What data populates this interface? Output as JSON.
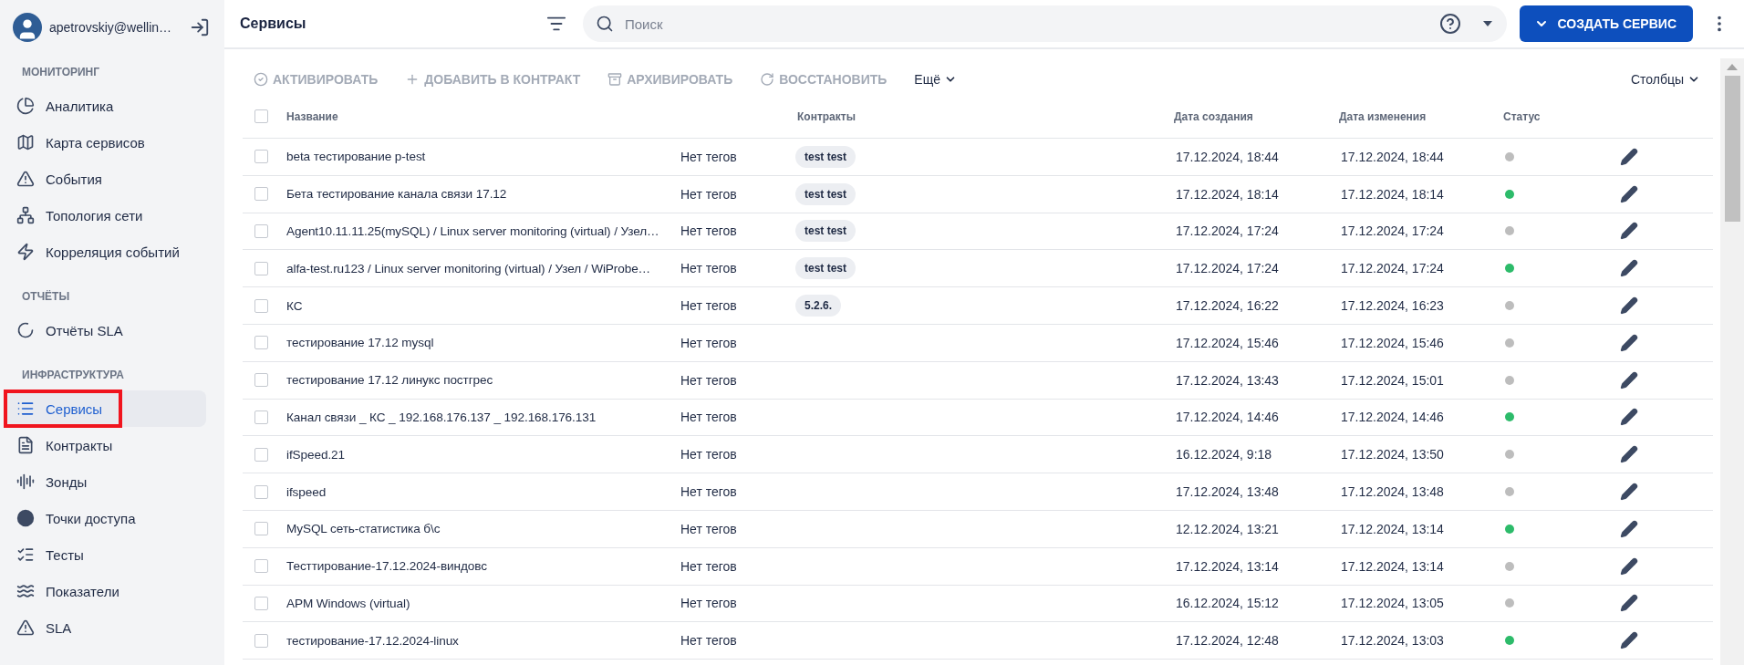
{
  "user": {
    "name": "apetrovskiy@wellin…"
  },
  "nav": [
    {
      "title": "МОНИТОРИНГ",
      "items": [
        {
          "label": "Аналитика",
          "selected": false,
          "highlighted": false
        },
        {
          "label": "Карта сервисов",
          "selected": false,
          "highlighted": false
        },
        {
          "label": "События",
          "selected": false,
          "highlighted": false
        },
        {
          "label": "Топология сети",
          "selected": false,
          "highlighted": false
        },
        {
          "label": "Корреляция событий",
          "selected": false,
          "highlighted": false
        }
      ]
    },
    {
      "title": "ОТЧЁТЫ",
      "items": [
        {
          "label": "Отчёты SLA",
          "selected": false,
          "highlighted": false
        }
      ]
    },
    {
      "title": "ИНФРАСТРУКТУРА",
      "items": [
        {
          "label": "Сервисы",
          "selected": true,
          "highlighted": true
        },
        {
          "label": "Контракты",
          "selected": false,
          "highlighted": false
        },
        {
          "label": "Зонды",
          "selected": false,
          "highlighted": false
        },
        {
          "label": "Точки доступа",
          "selected": false,
          "highlighted": false
        },
        {
          "label": "Тесты",
          "selected": false,
          "highlighted": false
        },
        {
          "label": "Показатели",
          "selected": false,
          "highlighted": false
        },
        {
          "label": "SLA",
          "selected": false,
          "highlighted": false
        }
      ]
    }
  ],
  "topbar": {
    "title": "Сервисы",
    "search": {
      "placeholder": "Поиск"
    },
    "create_button": "СОЗДАТЬ СЕРВИС"
  },
  "toolbar": {
    "actions": [
      {
        "label": "АКТИВИРОВАТЬ",
        "disabled": true
      },
      {
        "label": "ДОБАВИТЬ В КОНТРАКТ",
        "disabled": true
      },
      {
        "label": "АРХИВИРОВАТЬ",
        "disabled": true
      },
      {
        "label": "ВОССТАНОВИТЬ",
        "disabled": true
      }
    ],
    "more": "Ещё",
    "columns": "Столбцы"
  },
  "table": {
    "all_checked": false,
    "columns": [
      "Название",
      "Контракты",
      "Дата создания",
      "Дата изменения",
      "Статус"
    ],
    "rows": [
      {
        "name": "beta тестирование p-test",
        "tags": "Нет тегов",
        "contracts": [
          "test test"
        ],
        "created": "17.12.2024, 18:44",
        "modified": "17.12.2024, 18:44",
        "color": "#bdbdbd",
        "checked": false
      },
      {
        "name": "Бета тестирование канала связи 17.12",
        "tags": "Нет тегов",
        "contracts": [
          "test test"
        ],
        "created": "17.12.2024, 18:14",
        "modified": "17.12.2024, 18:14",
        "color": "#2dbb6a",
        "checked": false
      },
      {
        "name": "Agent10.11.11.25(mySQL) / Linux server monitoring (virtual) / Узел…",
        "tags": "Нет тегов",
        "contracts": [
          "test test"
        ],
        "created": "17.12.2024, 17:24",
        "modified": "17.12.2024, 17:24",
        "color": "#bdbdbd",
        "checked": false
      },
      {
        "name": "alfa-test.ru123 / Linux server monitoring (virtual) / Узел / WiProbe…",
        "tags": "Нет тегов",
        "contracts": [
          "test test"
        ],
        "created": "17.12.2024, 17:24",
        "modified": "17.12.2024, 17:24",
        "color": "#2dbb6a",
        "checked": false
      },
      {
        "name": "КС",
        "tags": "Нет тегов",
        "contracts": [
          "5.2.6."
        ],
        "created": "17.12.2024, 16:22",
        "modified": "17.12.2024, 16:23",
        "color": "#bdbdbd",
        "checked": false
      },
      {
        "name": "тестирование 17.12 mysql",
        "tags": "Нет тегов",
        "contracts": [],
        "created": "17.12.2024, 15:46",
        "modified": "17.12.2024, 15:46",
        "color": "#bdbdbd",
        "checked": false
      },
      {
        "name": "тестирование 17.12 линукс постгрес",
        "tags": "Нет тегов",
        "contracts": [],
        "created": "17.12.2024, 13:43",
        "modified": "17.12.2024, 15:01",
        "color": "#bdbdbd",
        "checked": false
      },
      {
        "name": "Канал связи _ КС _ 192.168.176.137 _ 192.168.176.131",
        "tags": "Нет тегов",
        "contracts": [],
        "created": "17.12.2024, 14:46",
        "modified": "17.12.2024, 14:46",
        "color": "#2dbb6a",
        "checked": false
      },
      {
        "name": "ifSpeed.21",
        "tags": "Нет тегов",
        "contracts": [],
        "created": "16.12.2024, 9:18",
        "modified": "17.12.2024, 13:50",
        "color": "#bdbdbd",
        "checked": false
      },
      {
        "name": "ifspeed",
        "tags": "Нет тегов",
        "contracts": [],
        "created": "17.12.2024, 13:48",
        "modified": "17.12.2024, 13:48",
        "color": "#bdbdbd",
        "checked": false
      },
      {
        "name": "MySQL сеть-статистика б\\с",
        "tags": "Нет тегов",
        "contracts": [],
        "created": "12.12.2024, 13:21",
        "modified": "17.12.2024, 13:14",
        "color": "#2dbb6a",
        "checked": false
      },
      {
        "name": "Тесттирование-17.12.2024-виндовс",
        "tags": "Нет тегов",
        "contracts": [],
        "created": "17.12.2024, 13:14",
        "modified": "17.12.2024, 13:14",
        "color": "#bdbdbd",
        "checked": false
      },
      {
        "name": "APM Windows (virtual)",
        "tags": "Нет тегов",
        "contracts": [],
        "created": "16.12.2024, 15:12",
        "modified": "17.12.2024, 13:05",
        "color": "#bdbdbd",
        "checked": false
      },
      {
        "name": "тестирование-17.12.2024-linux",
        "tags": "Нет тегов",
        "contracts": [],
        "created": "17.12.2024, 12:48",
        "modified": "17.12.2024, 13:03",
        "color": "#2dbb6a",
        "checked": false
      }
    ]
  }
}
